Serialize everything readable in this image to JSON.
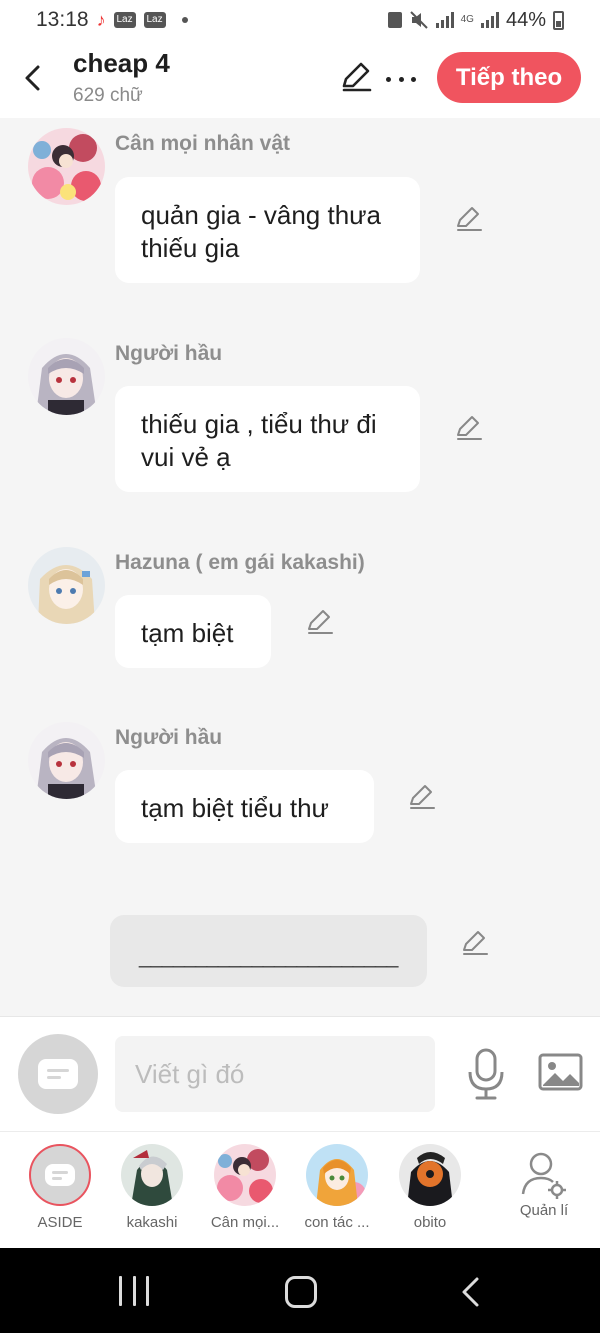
{
  "status_bar": {
    "time": "13:18",
    "laz_label": "Laz",
    "network": "4G",
    "battery": "44%"
  },
  "header": {
    "title": "cheap 4",
    "word_count": "629 chữ",
    "next_label": "Tiếp theo"
  },
  "messages": [
    {
      "speaker": "Cân mọi nhân vật",
      "text": "quản gia - vâng thưa thiếu gia",
      "avatar": "collage-avatar"
    },
    {
      "speaker": "Người hầu",
      "text": "thiếu gia , tiểu thư đi vui vẻ ạ",
      "avatar": "maid-avatar"
    },
    {
      "speaker": "Hazuna ( em gái kakashi)",
      "text": "tạm biệt",
      "avatar": "girl-avatar"
    },
    {
      "speaker": "Người hầu",
      "text": "tạm biệt tiểu thư",
      "avatar": "maid-avatar"
    }
  ],
  "draft": {
    "text": "_______________________"
  },
  "input": {
    "placeholder": "Viết gì đó"
  },
  "characters": [
    {
      "label": "ASIDE"
    },
    {
      "label": "kakashi"
    },
    {
      "label": "Cân mọi..."
    },
    {
      "label": "con tác ..."
    },
    {
      "label": "obito"
    },
    {
      "label": "Quản lí"
    }
  ],
  "colors": {
    "accent": "#f0545f",
    "background": "#f5f5f5",
    "bubble": "#ffffff"
  }
}
